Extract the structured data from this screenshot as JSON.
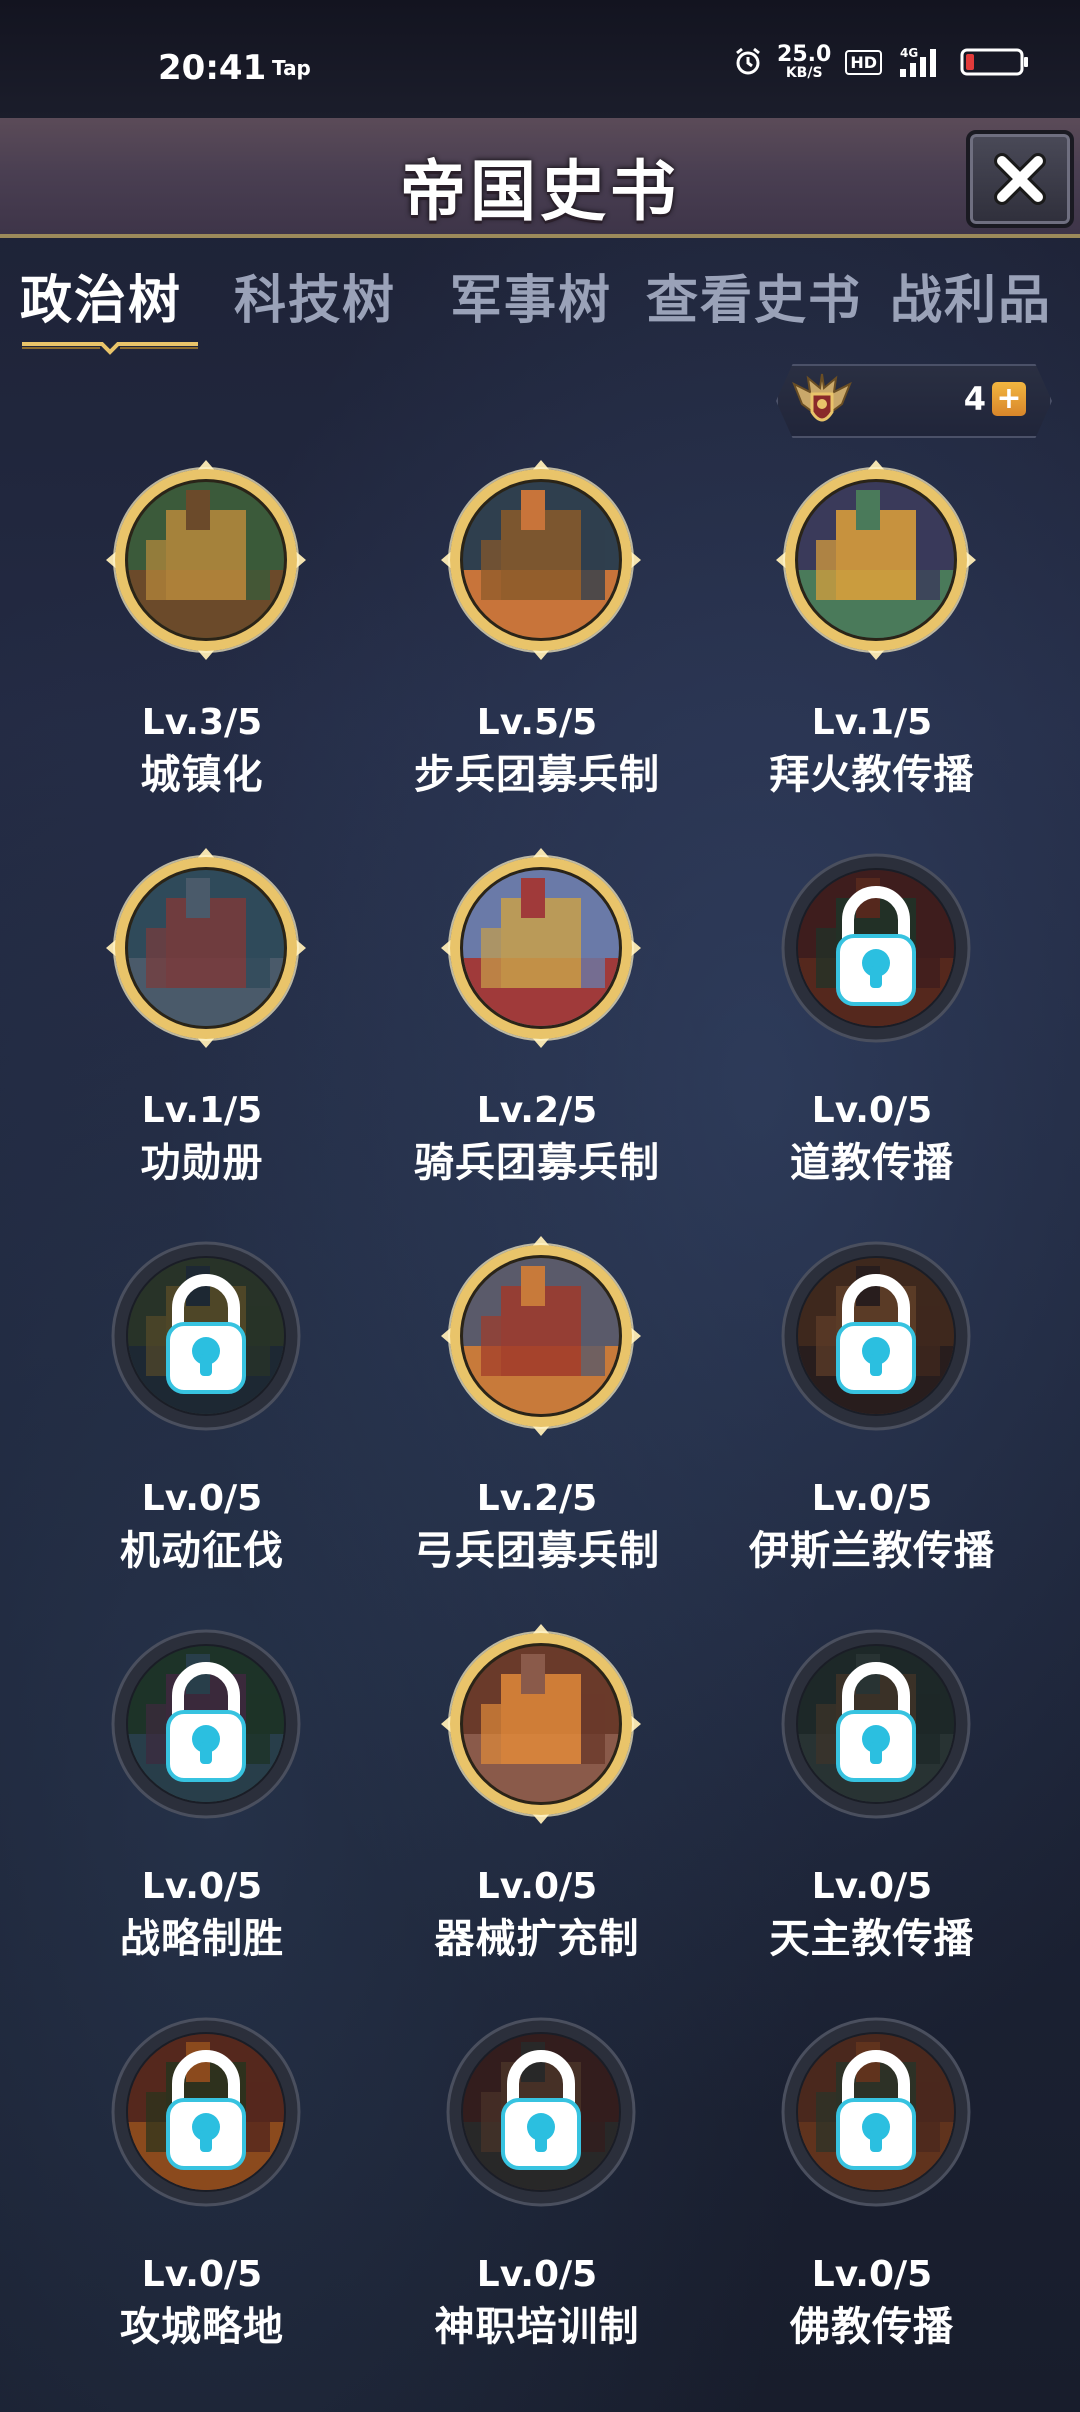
{
  "status_bar": {
    "time": "20:41",
    "tap": "Tap",
    "net_speed_value": "25.0",
    "net_speed_unit": "KB/S",
    "hd": "HD",
    "network": "4G"
  },
  "header": {
    "title": "帝国史书"
  },
  "tabs": [
    {
      "label": "政治树",
      "active": true
    },
    {
      "label": "科技树",
      "active": false
    },
    {
      "label": "军事树",
      "active": false
    },
    {
      "label": "查看史书",
      "active": false
    },
    {
      "label": "战利品",
      "active": false
    }
  ],
  "currency": {
    "count": "4",
    "plus": "+"
  },
  "nodes": [
    {
      "level": "Lv.3/5",
      "name": "城镇化",
      "unlocked": true,
      "colors": [
        "#3b5a3a",
        "#b98a3c",
        "#6b4a2a"
      ]
    },
    {
      "level": "Lv.5/5",
      "name": "步兵团募兵制",
      "unlocked": true,
      "colors": [
        "#2f3f4e",
        "#8a5a2a",
        "#c8743a"
      ]
    },
    {
      "level": "Lv.1/5",
      "name": "拜火教传播",
      "unlocked": true,
      "colors": [
        "#3a3a5a",
        "#e0a23a",
        "#4a7a5a"
      ]
    },
    {
      "level": "Lv.1/5",
      "name": "功勋册",
      "unlocked": true,
      "colors": [
        "#2f4a5a",
        "#7a3a3a",
        "#4a5a6a"
      ]
    },
    {
      "level": "Lv.2/5",
      "name": "骑兵团募兵制",
      "unlocked": true,
      "colors": [
        "#6a7aa8",
        "#c8a04a",
        "#a03a3a"
      ]
    },
    {
      "level": "Lv.0/5",
      "name": "道教传播",
      "unlocked": false,
      "colors": [
        "#5a2a2a",
        "#2a4a3a",
        "#7a3a2a"
      ]
    },
    {
      "level": "Lv.0/5",
      "name": "机动征伐",
      "unlocked": false,
      "colors": [
        "#3a4a3a",
        "#7a6a3a",
        "#2a3a4a"
      ]
    },
    {
      "level": "Lv.2/5",
      "name": "弓兵团募兵制",
      "unlocked": true,
      "colors": [
        "#5a5a6a",
        "#a03a2a",
        "#c87a3a"
      ]
    },
    {
      "level": "Lv.0/5",
      "name": "伊斯兰教传播",
      "unlocked": false,
      "colors": [
        "#5a3a2a",
        "#8a5a3a",
        "#3a2a2a"
      ]
    },
    {
      "level": "Lv.0/5",
      "name": "战略制胜",
      "unlocked": false,
      "colors": [
        "#2a4a3a",
        "#5a3a5a",
        "#3a5a6a"
      ]
    },
    {
      "level": "Lv.0/5",
      "name": "器械扩充制",
      "unlocked": true,
      "colors": [
        "#6a3a2a",
        "#e08a3a",
        "#8a5a4a"
      ]
    },
    {
      "level": "Lv.0/5",
      "name": "天主教传播",
      "unlocked": false,
      "colors": [
        "#2a3a3a",
        "#5a4a3a",
        "#3a4a4a"
      ]
    },
    {
      "level": "Lv.0/5",
      "name": "攻城略地",
      "unlocked": false,
      "colors": [
        "#7a3a2a",
        "#3a4a2a",
        "#c86a2a"
      ]
    },
    {
      "level": "Lv.0/5",
      "name": "神职培训制",
      "unlocked": false,
      "colors": [
        "#4a2a2a",
        "#6a4a3a",
        "#3a3a3a"
      ]
    },
    {
      "level": "Lv.0/5",
      "name": "佛教传播",
      "unlocked": false,
      "colors": [
        "#6a3a2a",
        "#3a4a3a",
        "#8a4a2a"
      ]
    }
  ]
}
